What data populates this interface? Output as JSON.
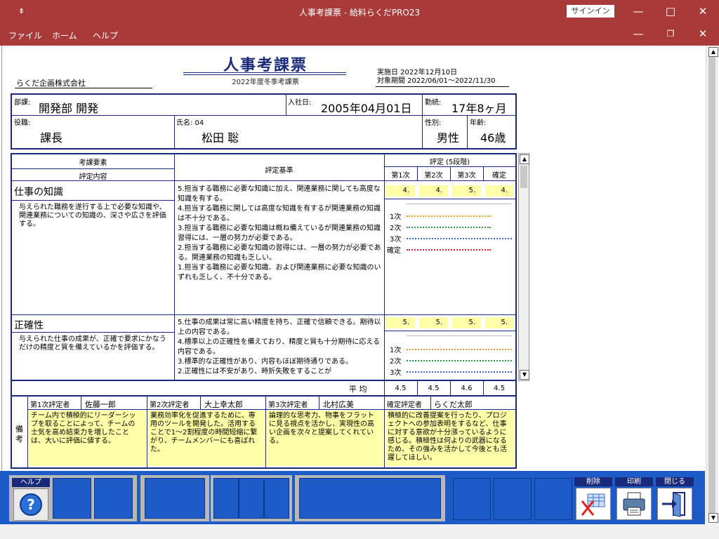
{
  "window": {
    "title": "人事考課票 - 給料らくだPRO23",
    "signin": "サインイン"
  },
  "menu": [
    "ファイル",
    "ホーム",
    "ヘルプ"
  ],
  "doc": {
    "title": "人事考課票",
    "subtitle": "2022年度冬季考課票",
    "company": "らくだ企画株式会社",
    "impl_date": "実施日 2022年12月10日",
    "period": "対象期間 2022/06/01～2022/11/30",
    "info": {
      "dept_label": "部課:",
      "dept": "開発部 開発",
      "join_label": "入社日:",
      "join": "2005年04月01日",
      "tenure_label": "勤続:",
      "tenure": "17年8ヶ月",
      "role_label": "役職:",
      "role": "課長",
      "name_label": "氏名: 04",
      "name": "松田 聡",
      "sex_label": "性別:",
      "sex": "男性",
      "age_label": "年齢:",
      "age": "46歳"
    },
    "table": {
      "h_element": "考課要素",
      "h_content": "評定内容",
      "h_criteria": "評定基準",
      "h_eval": "評定 (5段階)",
      "h_cols": [
        "第1次",
        "第2次",
        "第3次",
        "確定"
      ],
      "items": [
        {
          "name": "仕事の知識",
          "desc": "与えられた職務を遂行する上で必要な知識や、関連業務についての知識の、深さや広さを評価する。",
          "criteria": "5.担当する職務に必要な知識に加え、関連業務に関しても高度な知識を有する。\n4.担当する職務に関しては高度な知識を有するが関連業務の知識は不十分である。\n3.担当する職務に必要な知識は概ね備えているが関連業務の知識習得には、一層の努力が必要である。\n2.担当する職務に必要な知識の習得には、一層の努力が必要である。関連業務の知識も乏しい。\n1.担当する職務に必要な知識、および関連業務に必要な知識のいずれも乏しく、不十分である。",
          "scores": [
            "4.",
            "4.",
            "5.",
            "4."
          ],
          "levels": [
            4,
            4,
            5,
            4
          ]
        },
        {
          "name": "正確性",
          "desc": "与えられた仕事の成果が、正確で要求にかなうだけの精度と質を備えているかを評価する。",
          "criteria": "5.仕事の成果は常に高い精度を持ち、正確で信頼できる。期待以上の内容である。\n4.標準以上の正確性を備えており、精度と質も十分期待に応える内容である。\n3.標準的な正確性があり、内容もほぼ期待通りである。\n2.正確性には不安があり、時折失敗をすることが",
          "scores": [
            "5.",
            "5.",
            "5.",
            "5."
          ],
          "levels": [
            5,
            5,
            5,
            5
          ]
        }
      ],
      "chart_rows": [
        "1次",
        "2次",
        "3次",
        "確定"
      ],
      "chart_colors": [
        "#f0a020",
        "#2a9a4a",
        "#3a6ad8",
        "#e02020"
      ],
      "avg_label": "平 均",
      "averages": [
        "4.5",
        "4.5",
        "4.6",
        "4.5"
      ]
    },
    "evaluators": [
      {
        "role": "第1次評定者",
        "name": "佐藤一郎",
        "comment": "チーム内で積極的にリーダーシップを取ることによって、チームの士気を高め結束力を増したことは、大いに評価に値する。"
      },
      {
        "role": "第2次評定者",
        "name": "大上幸太郎",
        "comment": "業務効率化を促進するために、専用のツールを開発した。活用することで1～2割程度の時間短縮に繋がり、チームメンバーにも喜ばれた。"
      },
      {
        "role": "第3次評定者",
        "name": "北村広美",
        "comment": "論理的な思考力、物事をフラットに見る視点を活かし、実現性の高い企画を次々と提案してくれている。"
      },
      {
        "role": "確定評定者",
        "name": "らくだ太郎",
        "comment": "積極的に改善提案を行ったり、プロジェクトへの参加表明をするなど、仕事に対する意欲が十分漲っているように感じる。積極性は何よりの武器になるため、その強みを活かして今後とも活躍してほしい。"
      }
    ],
    "remarks_label": "備考"
  },
  "toolbar": {
    "help": "ヘルプ",
    "delete": "削除",
    "print": "印刷",
    "close": "閉じる"
  }
}
